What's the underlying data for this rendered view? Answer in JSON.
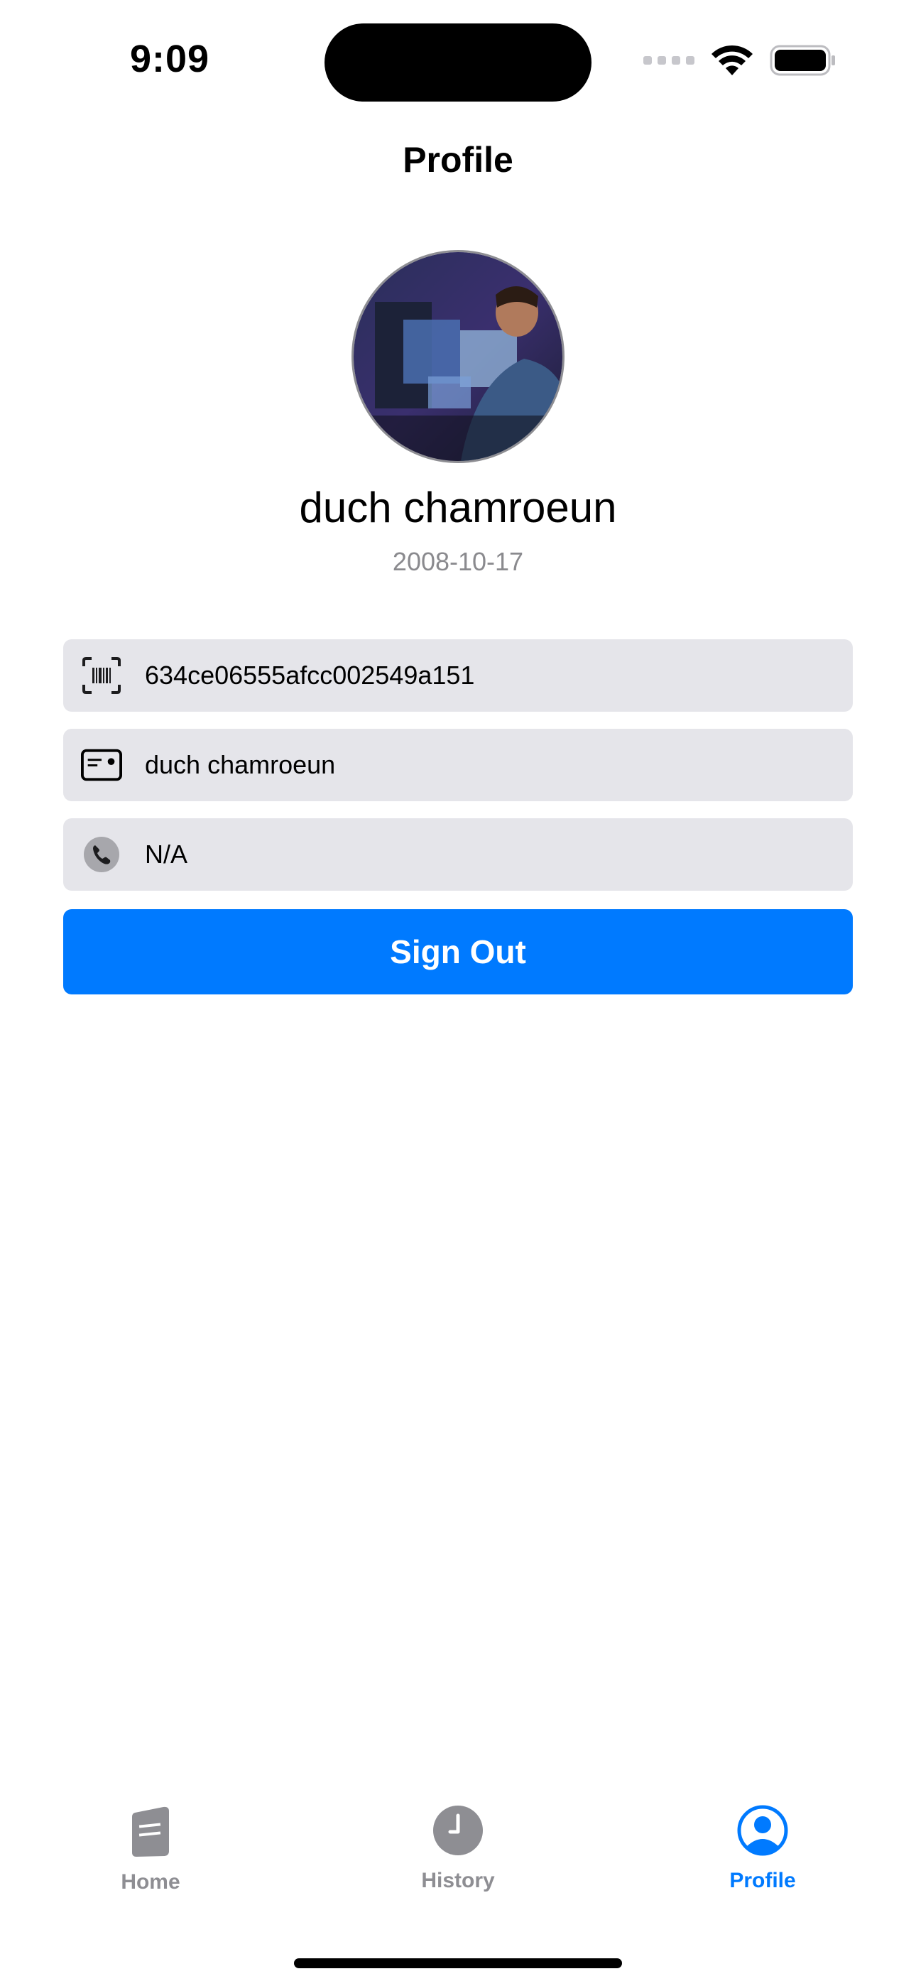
{
  "status_bar": {
    "time": "9:09"
  },
  "nav": {
    "title": "Profile"
  },
  "profile": {
    "name": "duch chamroeun",
    "dob": "2008-10-17"
  },
  "fields": [
    {
      "icon": "barcode-scan-icon",
      "value": "634ce06555afcc002549a151"
    },
    {
      "icon": "id-card-icon",
      "value": "duch chamroeun"
    },
    {
      "icon": "phone-icon",
      "value": "N/A"
    }
  ],
  "actions": {
    "sign_out_label": "Sign Out"
  },
  "tab_bar": {
    "tabs": [
      {
        "label": "Home",
        "icon": "document-icon",
        "active": false
      },
      {
        "label": "History",
        "icon": "clock-icon",
        "active": false
      },
      {
        "label": "Profile",
        "icon": "person-circle-icon",
        "active": true
      }
    ]
  },
  "colors": {
    "accent": "#007aff",
    "field_bg": "#e5e5ea",
    "inactive_tab": "#8e8e93"
  }
}
